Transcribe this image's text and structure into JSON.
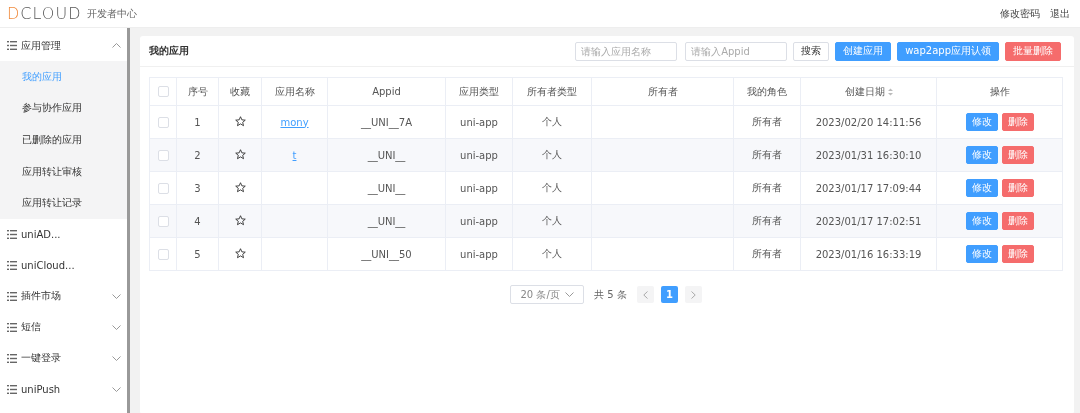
{
  "header": {
    "logo": "DCLOUD",
    "subtitle": "开发者中心",
    "links": [
      "修改密码",
      "退出"
    ]
  },
  "sidebar": {
    "items": [
      {
        "label": "应用管理",
        "expanded": true,
        "has_arrow": true,
        "children": [
          {
            "label": "我的应用",
            "selected": true
          },
          {
            "label": "参与协作应用",
            "selected": false
          },
          {
            "label": "已删除的应用",
            "selected": false
          },
          {
            "label": "应用转让审核",
            "selected": false
          },
          {
            "label": "应用转让记录",
            "selected": false
          }
        ]
      },
      {
        "label": "uniAD...",
        "has_arrow": false
      },
      {
        "label": "uniCloud...",
        "has_arrow": false
      },
      {
        "label": "插件市场",
        "expanded": false,
        "has_arrow": true
      },
      {
        "label": "短信",
        "expanded": false,
        "has_arrow": true
      },
      {
        "label": "一键登录",
        "expanded": false,
        "has_arrow": true
      },
      {
        "label": "uniPush",
        "expanded": false,
        "has_arrow": true
      }
    ]
  },
  "panel": {
    "title": "我的应用",
    "search_fields": [
      {
        "placeholder": "请输入应用名称"
      },
      {
        "placeholder": "请输入Appid"
      }
    ],
    "buttons": [
      {
        "label": "搜索",
        "kind": "plain"
      },
      {
        "label": "创建应用",
        "kind": "primary"
      },
      {
        "label": "wap2app应用认领",
        "kind": "primary"
      },
      {
        "label": "批量删除",
        "kind": "danger"
      }
    ],
    "table": {
      "select_all_checked": false,
      "columns": [
        "序号",
        "收藏",
        "应用名称",
        "Appid",
        "应用类型",
        "所有者类型",
        "所有者",
        "我的角色",
        "创建日期",
        "操作"
      ],
      "rows": [
        {
          "checked": false,
          "index": "1",
          "favorite": false,
          "name": "mony",
          "appid": "__UNI__7A",
          "type": "uni-app",
          "owner_type": "个人",
          "role": "所有者",
          "created": "2023/02/20 14:11:56",
          "actions": [
            "修改",
            "删除"
          ]
        },
        {
          "checked": false,
          "index": "2",
          "favorite": false,
          "name": "t",
          "appid": "__UNI__",
          "type": "uni-app",
          "owner_type": "个人",
          "role": "所有者",
          "created": "2023/01/31 16:30:10",
          "actions": [
            "修改",
            "删除"
          ]
        },
        {
          "checked": false,
          "index": "3",
          "favorite": false,
          "appid": "__UNI__",
          "type": "uni-app",
          "owner_type": "个人",
          "role": "所有者",
          "created": "2023/01/17 17:09:44",
          "actions": [
            "修改",
            "删除"
          ]
        },
        {
          "checked": false,
          "index": "4",
          "favorite": false,
          "appid": "__UNI__",
          "type": "uni-app",
          "owner_type": "个人",
          "role": "所有者",
          "created": "2023/01/17 17:02:51",
          "actions": [
            "修改",
            "删除"
          ]
        },
        {
          "checked": false,
          "index": "5",
          "favorite": false,
          "appid": "__UNI__50",
          "type": "uni-app",
          "owner_type": "个人",
          "role": "所有者",
          "created": "2023/01/16 16:33:19",
          "actions": [
            "修改",
            "删除"
          ]
        }
      ]
    },
    "pagination": {
      "page_size": "20 条/页",
      "total": "共 5 条",
      "pages": [
        {
          "label": "1",
          "selected": true
        }
      ]
    }
  }
}
